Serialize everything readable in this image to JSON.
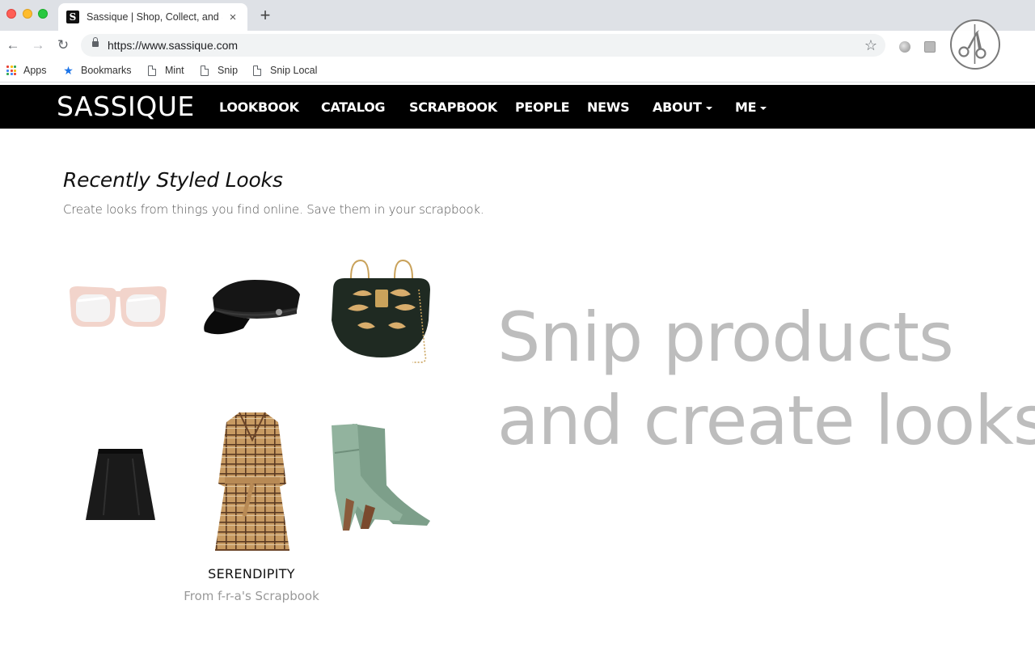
{
  "browser": {
    "tab": {
      "favicon_letter": "S",
      "title": "Sassique | Shop, Collect, and S",
      "close": "×"
    },
    "new_tab": "+",
    "url": "https://www.sassique.com",
    "nav_icons": {
      "back": "←",
      "forward": "→",
      "reload": "↻",
      "star": "☆"
    },
    "bookmarks": [
      {
        "label": "Apps",
        "icon": "apps-grid-icon"
      },
      {
        "label": "Bookmarks",
        "icon": "star-icon"
      },
      {
        "label": "Mint",
        "icon": "page-icon"
      },
      {
        "label": "Snip",
        "icon": "page-icon"
      },
      {
        "label": "Snip Local",
        "icon": "page-icon"
      }
    ],
    "update_arrow": "↑"
  },
  "site": {
    "logo": "SASSIQUE",
    "nav": [
      "LOOKBOOK",
      "CATALOG",
      "SCRAPBOOK",
      "PEOPLE",
      "NEWS",
      "ABOUT",
      "ME"
    ],
    "section_title": "Recently Styled Looks",
    "section_subtitle": "Create looks from things you find online. Save them in your scrapbook.",
    "products": [
      "sunglasses",
      "cap",
      "handbag",
      "skirt",
      "trench-coat",
      "ankle-boots"
    ],
    "look": {
      "name": "SERENDIPITY",
      "from_prefix": "From ",
      "from_link": "f-r-a's Scrapbook"
    },
    "hero_line1": "Snip products",
    "hero_line2": "and create looks"
  },
  "colors": {
    "nav_bg": "#000000",
    "hero_text": "#bdbdbd",
    "chrome_bg": "#dee1e6"
  }
}
